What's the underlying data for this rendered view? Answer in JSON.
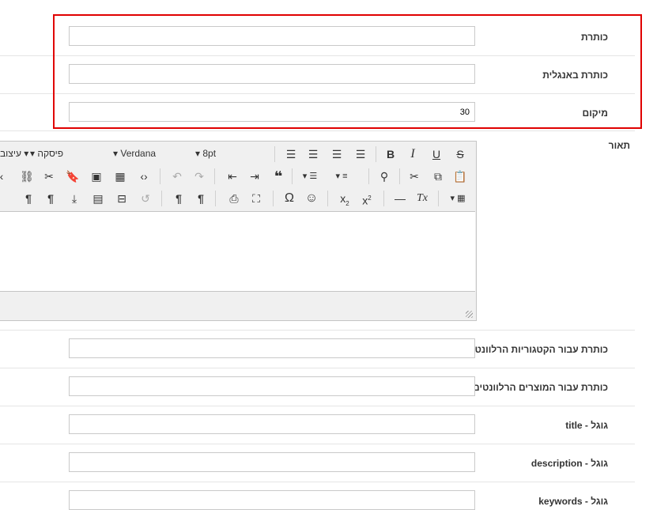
{
  "fields": {
    "title": {
      "label": "כותרת",
      "value": ""
    },
    "title_en": {
      "label": "כותרת באנגלית",
      "value": ""
    },
    "position": {
      "label": "מיקום",
      "value": "30"
    },
    "description": {
      "label": "תאור"
    },
    "cat_title": {
      "label": "כותרת עבור הקטגוריות הרלוונטיות",
      "value": ""
    },
    "prod_title": {
      "label": "כותרת עבור המוצרים הרלוונטים",
      "value": ""
    },
    "google_title": {
      "label": "גוגל - title",
      "value": ""
    },
    "google_description": {
      "label": "גוגל - description",
      "value": ""
    },
    "google_keywords": {
      "label": "גוגל - keywords",
      "value": ""
    }
  },
  "editor": {
    "format_menu": "עיצוב",
    "paragraph_select": "פיסקה",
    "font_select": "Verdana",
    "size_select": "8pt"
  },
  "colors": {
    "highlight": "#e00000",
    "border": "#c9c9c9"
  }
}
